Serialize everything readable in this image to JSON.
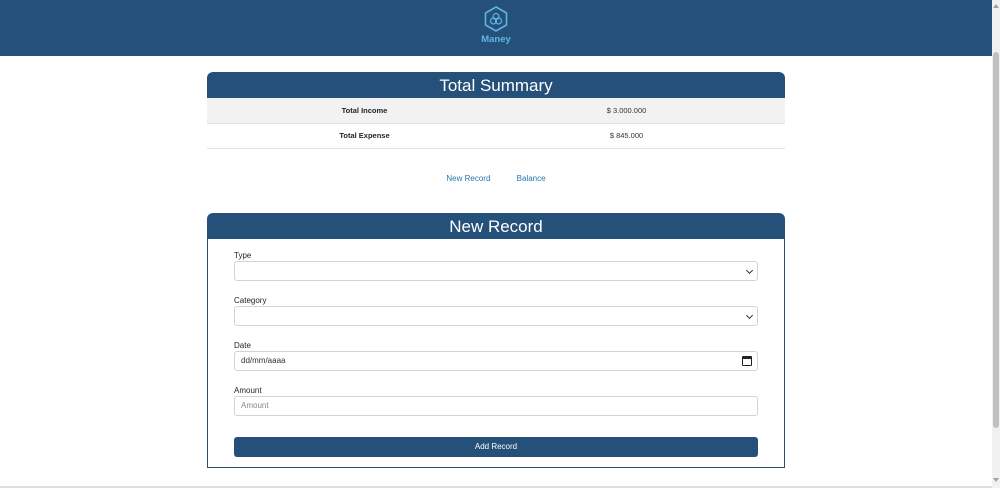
{
  "brand": {
    "name": "Maney"
  },
  "summary": {
    "title": "Total Summary",
    "rows": [
      {
        "label": "Total Income",
        "value": "$ 3.000.000"
      },
      {
        "label": "Total Expense",
        "value": "$ 845.000"
      }
    ]
  },
  "nav": {
    "new_record": "New Record",
    "balance": "Balance"
  },
  "form": {
    "title": "New Record",
    "type_label": "Type",
    "type_value": "",
    "category_label": "Category",
    "category_value": "",
    "date_label": "Date",
    "date_placeholder": "dd/mm/aaaa",
    "amount_label": "Amount",
    "amount_placeholder": "Amount",
    "submit_label": "Add Record"
  },
  "colors": {
    "primary": "#255079",
    "link": "#1f78b4",
    "logo_accent": "#5fb6e0"
  }
}
